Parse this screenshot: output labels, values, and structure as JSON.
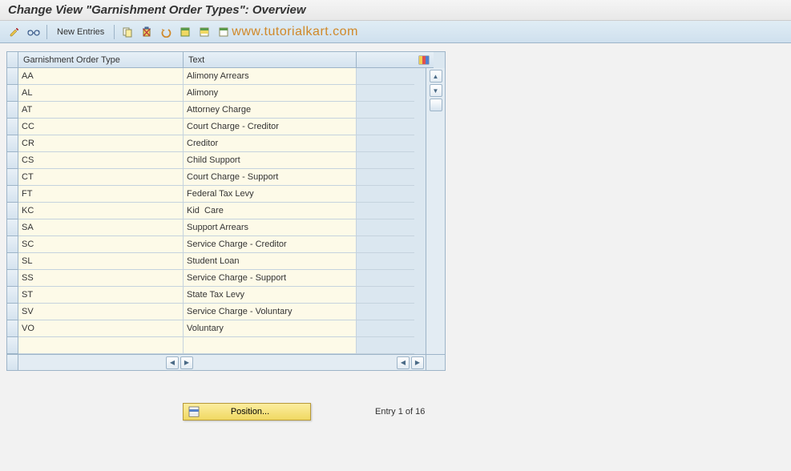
{
  "title": "Change View \"Garnishment Order Types\": Overview",
  "watermark": "www.tutorialkart.com",
  "toolbar": {
    "new_entries_label": "New Entries"
  },
  "table": {
    "columns": {
      "code": "Garnishment Order Type",
      "text": "Text"
    },
    "rows": [
      {
        "code": "AA",
        "text": "Alimony Arrears"
      },
      {
        "code": "AL",
        "text": "Alimony"
      },
      {
        "code": "AT",
        "text": "Attorney Charge"
      },
      {
        "code": "CC",
        "text": "Court Charge - Creditor"
      },
      {
        "code": "CR",
        "text": "Creditor"
      },
      {
        "code": "CS",
        "text": "Child Support"
      },
      {
        "code": "CT",
        "text": "Court Charge - Support"
      },
      {
        "code": "FT",
        "text": "Federal Tax Levy"
      },
      {
        "code": "KC",
        "text": "Kid  Care"
      },
      {
        "code": "SA",
        "text": "Support Arrears"
      },
      {
        "code": "SC",
        "text": "Service Charge - Creditor"
      },
      {
        "code": "SL",
        "text": "Student Loan"
      },
      {
        "code": "SS",
        "text": "Service Charge - Support"
      },
      {
        "code": "ST",
        "text": "State Tax Levy"
      },
      {
        "code": "SV",
        "text": "Service Charge - Voluntary"
      },
      {
        "code": "VO",
        "text": "Voluntary"
      },
      {
        "code": "",
        "text": ""
      }
    ]
  },
  "footer": {
    "position_label": "Position...",
    "entry_status": "Entry 1 of 16"
  }
}
